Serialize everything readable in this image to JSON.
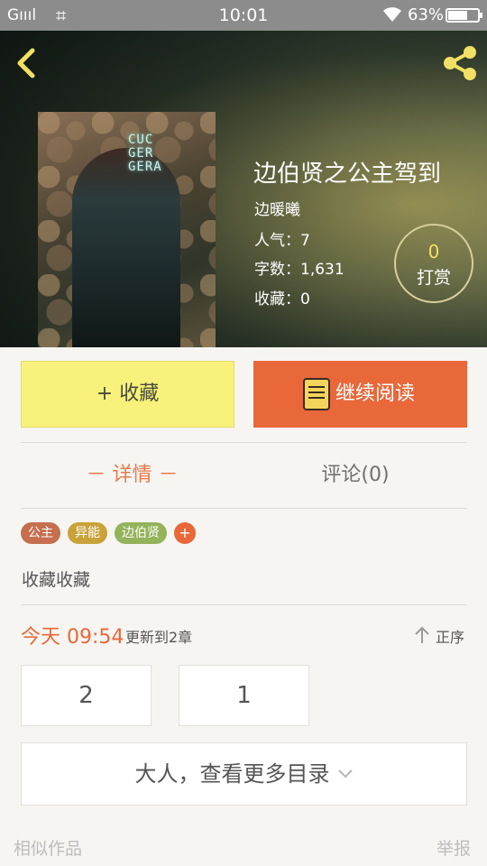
{
  "status_bar": {
    "signal": "Gıııl",
    "time": "10:01",
    "battery_pct": "63%"
  },
  "book": {
    "title": "边伯贤之公主驾到",
    "author": "边暖曦",
    "popularity": "人气：7",
    "word_count": "字数：1,631",
    "favorites": "收藏：0",
    "cover_text": "CUC\nGER\nGERA",
    "tip_count": "0",
    "tip_label": "打赏"
  },
  "actions": {
    "collect_label": "+ 收藏",
    "read_label": "继续阅读"
  },
  "tabs": {
    "detail": "－ 详情 －",
    "comment": "评论(0)"
  },
  "tags": [
    {
      "label": "公主",
      "color": "#c56f4e"
    },
    {
      "label": "异能",
      "color": "#c9a23a"
    },
    {
      "label": "边伯贤",
      "color": "#94b35a"
    }
  ],
  "tag_add": "+",
  "description": "收藏收藏",
  "update": {
    "time": "今天 09:54",
    "text": "更新到2章",
    "sort_label": "正序"
  },
  "chapters": [
    "2",
    "1"
  ],
  "more_toc": "大人，查看更多目录",
  "footer": {
    "similar": "相似作品",
    "report": "举报"
  },
  "colors": {
    "accent_orange": "#e8683a",
    "collect_yellow": "#f8f27c",
    "icon_yellow": "#f1e063"
  }
}
